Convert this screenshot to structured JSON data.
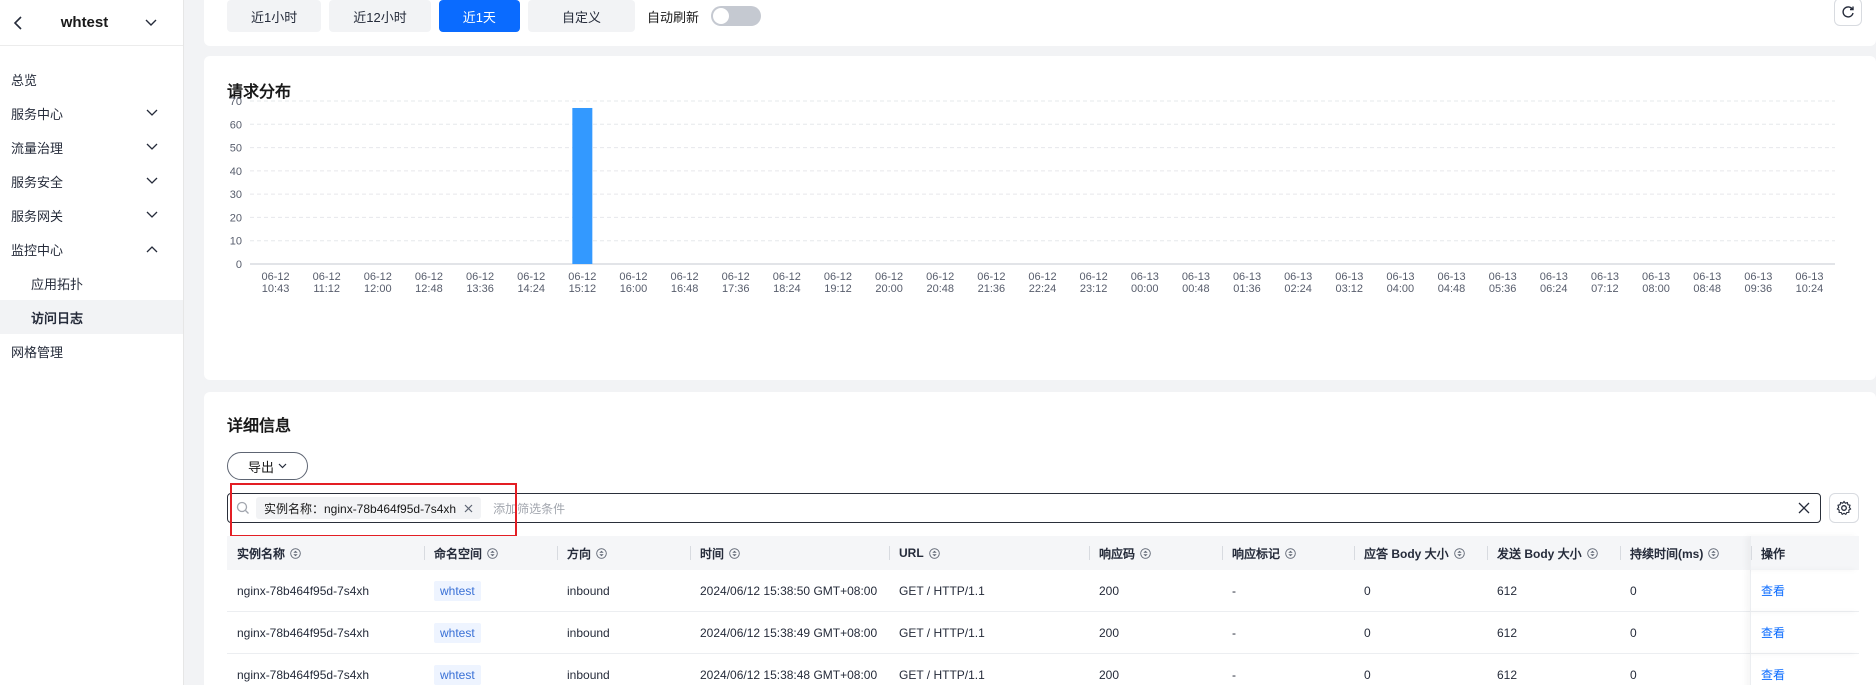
{
  "sidebar": {
    "title": "whtest",
    "items": [
      {
        "label": "总览",
        "arrow": ""
      },
      {
        "label": "服务中心",
        "arrow": "down"
      },
      {
        "label": "流量治理",
        "arrow": "down"
      },
      {
        "label": "服务安全",
        "arrow": "down"
      },
      {
        "label": "服务网关",
        "arrow": "down"
      },
      {
        "label": "监控中心",
        "arrow": "up"
      },
      {
        "label": "应用拓扑",
        "arrow": ""
      },
      {
        "label": "访问日志",
        "arrow": ""
      },
      {
        "label": "网格管理",
        "arrow": ""
      }
    ]
  },
  "toolbar": {
    "range_1h": "近1小时",
    "range_12h": "近12小时",
    "range_1d": "近1天",
    "range_custom": "自定义",
    "auto_refresh": "自动刷新"
  },
  "chart_card": {
    "title": "请求分布"
  },
  "chart_data": {
    "type": "bar",
    "title": "请求分布",
    "xlabel": "",
    "ylabel": "",
    "ylim": [
      0,
      70
    ],
    "yticks": [
      0,
      10,
      20,
      30,
      40,
      50,
      60,
      70
    ],
    "categories": [
      "06-12 10:43",
      "06-12 11:12",
      "06-12 12:00",
      "06-12 12:48",
      "06-12 13:36",
      "06-12 14:24",
      "06-12 15:12",
      "06-12 16:00",
      "06-12 16:48",
      "06-12 17:36",
      "06-12 18:24",
      "06-12 19:12",
      "06-12 20:00",
      "06-12 20:48",
      "06-12 21:36",
      "06-12 22:24",
      "06-12 23:12",
      "06-13 00:00",
      "06-13 00:48",
      "06-13 01:36",
      "06-13 02:24",
      "06-13 03:12",
      "06-13 04:00",
      "06-13 04:48",
      "06-13 05:36",
      "06-13 06:24",
      "06-13 07:12",
      "06-13 08:00",
      "06-13 08:48",
      "06-13 09:36",
      "06-13 10:24"
    ],
    "values": [
      0,
      0,
      0,
      0,
      0,
      0,
      67,
      0,
      0,
      0,
      0,
      0,
      0,
      0,
      0,
      0,
      0,
      0,
      0,
      0,
      0,
      0,
      0,
      0,
      0,
      0,
      0,
      0,
      0,
      0,
      0
    ],
    "color": "#3399ff",
    "grid": true
  },
  "detail": {
    "title": "详细信息",
    "export_label": "导出",
    "filter_tag": "实例名称：nginx-78b464f95d-7s4xh",
    "filter_placeholder": "添加筛选条件",
    "columns": [
      "实例名称",
      "命名空间",
      "方向",
      "时间",
      "URL",
      "响应码",
      "响应标记",
      "应答 Body 大小",
      "发送 Body 大小",
      "持续时间(ms)",
      "操作"
    ],
    "rows": [
      {
        "instance": "nginx-78b464f95d-7s4xh",
        "namespace": "whtest",
        "direction": "inbound",
        "time": "2024/06/12 15:38:50 GMT+08:00",
        "url": "GET / HTTP/1.1",
        "code": "200",
        "flag": "-",
        "resp_body": "0",
        "send_body": "612",
        "duration": "0",
        "action": "查看"
      },
      {
        "instance": "nginx-78b464f95d-7s4xh",
        "namespace": "whtest",
        "direction": "inbound",
        "time": "2024/06/12 15:38:49 GMT+08:00",
        "url": "GET / HTTP/1.1",
        "code": "200",
        "flag": "-",
        "resp_body": "0",
        "send_body": "612",
        "duration": "0",
        "action": "查看"
      },
      {
        "instance": "nginx-78b464f95d-7s4xh",
        "namespace": "whtest",
        "direction": "inbound",
        "time": "2024/06/12 15:38:48 GMT+08:00",
        "url": "GET / HTTP/1.1",
        "code": "200",
        "flag": "-",
        "resp_body": "0",
        "send_body": "612",
        "duration": "0",
        "action": "查看"
      }
    ]
  }
}
